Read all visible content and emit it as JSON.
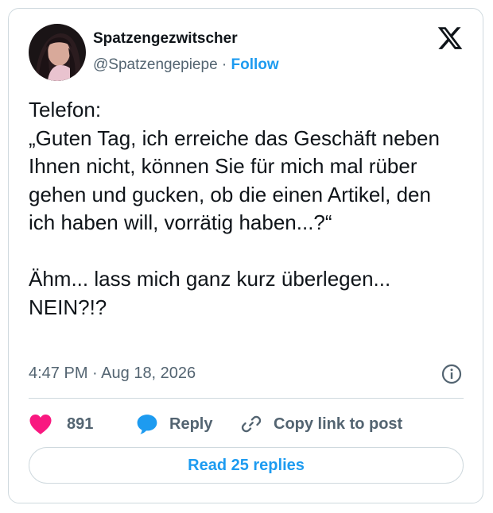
{
  "author": {
    "display_name": "Spatzengezwitscher",
    "handle": "@Spatzengepiepe",
    "separator": "·",
    "follow_label": "Follow"
  },
  "tweet": {
    "text": "Telefon:\n„Guten Tag, ich erreiche das Geschäft neben Ihnen nicht, können Sie für mich mal rüber gehen und gucken, ob die einen Artikel, den ich haben will, vorrätig haben...?“\n\nÄhm... lass mich ganz kurz überlegen...\nNEIN?!?",
    "time": "4:47 PM",
    "date_separator": "·",
    "date": "Aug 18, 2026"
  },
  "actions": {
    "like_count": "891",
    "reply_label": "Reply",
    "copy_label": "Copy link to post"
  },
  "read_replies_label": "Read 25 replies",
  "colors": {
    "accent": "#1d9bf0",
    "like": "#f91880",
    "text": "#0f1419",
    "muted": "#536471",
    "border": "#cfd9de"
  },
  "icons": {
    "brand": "x-logo-icon",
    "info": "info-icon",
    "like": "heart-icon",
    "reply": "speech-bubble-icon",
    "copy": "link-icon"
  }
}
